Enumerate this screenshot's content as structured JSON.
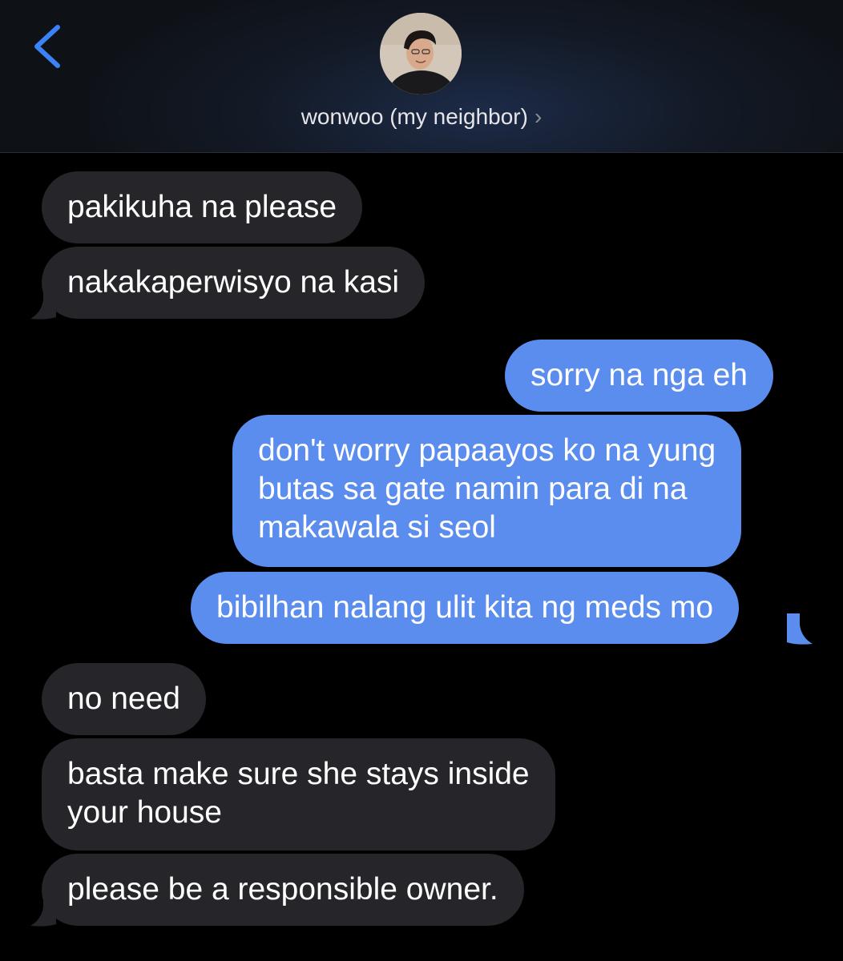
{
  "header": {
    "back_icon": "chevron-left-icon",
    "contact_name": "wonwoo (my neighbor)",
    "contact_chevron": "›",
    "accent_color": "#3b82f6"
  },
  "messages": [
    {
      "side": "incoming",
      "text": "pakikuha na please"
    },
    {
      "side": "incoming",
      "text": "nakakaperwisyo na kasi"
    },
    {
      "side": "outgoing",
      "text": "sorry na nga eh"
    },
    {
      "side": "outgoing",
      "lines": [
        "don't worry papaayos ko na yung",
        "butas sa gate namin para di na",
        "makawala si seol"
      ]
    },
    {
      "side": "outgoing",
      "text": "bibilhan nalang ulit kita ng meds mo"
    },
    {
      "side": "incoming",
      "text": "no need"
    },
    {
      "side": "incoming",
      "lines": [
        "basta make sure she stays inside",
        "your house"
      ]
    },
    {
      "side": "incoming",
      "text": "please be a responsible owner."
    }
  ],
  "colors": {
    "incoming_bubble": "#26252a",
    "outgoing_bubble": "#5b8def",
    "background": "#000000"
  }
}
